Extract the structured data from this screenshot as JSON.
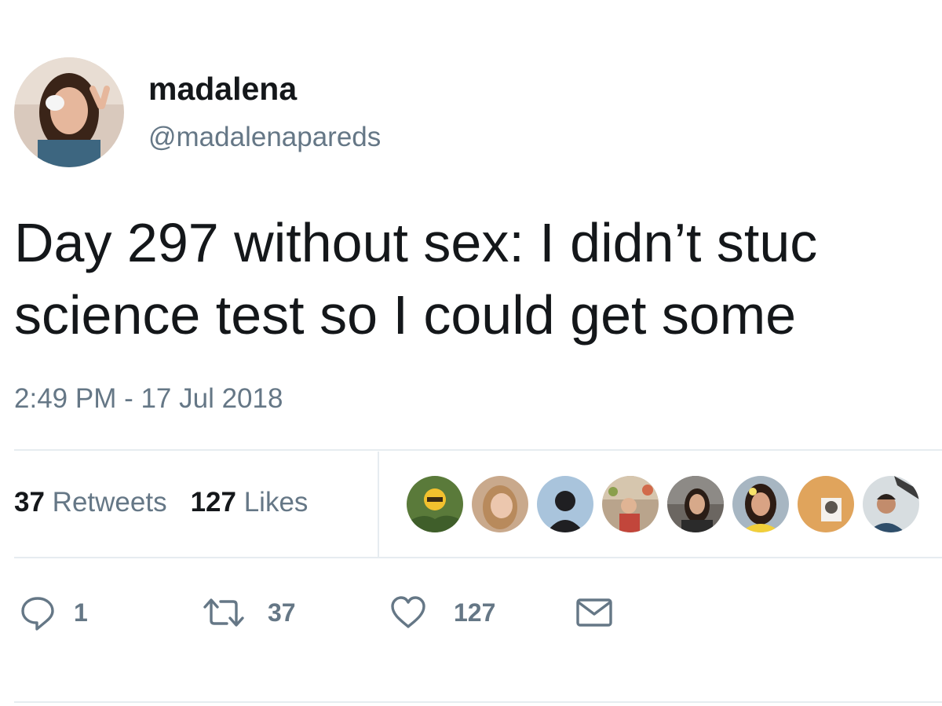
{
  "user": {
    "display_name": "madalena",
    "handle": "@madalenapareds"
  },
  "tweet": {
    "text_lines": [
      "Day 297 without sex: I didn’t stuc",
      "science test so I could get some"
    ],
    "timestamp": "2:49 PM - 17 Jul 2018"
  },
  "stats": {
    "retweets_count": "37",
    "retweets_label": "Retweets",
    "likes_count": "127",
    "likes_label": "Likes"
  },
  "actions": {
    "reply": {
      "icon": "reply-icon",
      "count": "1"
    },
    "retweet": {
      "icon": "retweet-icon",
      "count": "37"
    },
    "like": {
      "icon": "heart-icon",
      "count": "127"
    },
    "message": {
      "icon": "envelope-icon"
    }
  },
  "colors": {
    "text": "#14171a",
    "secondary": "#657786",
    "divider": "#e6ecf0"
  }
}
